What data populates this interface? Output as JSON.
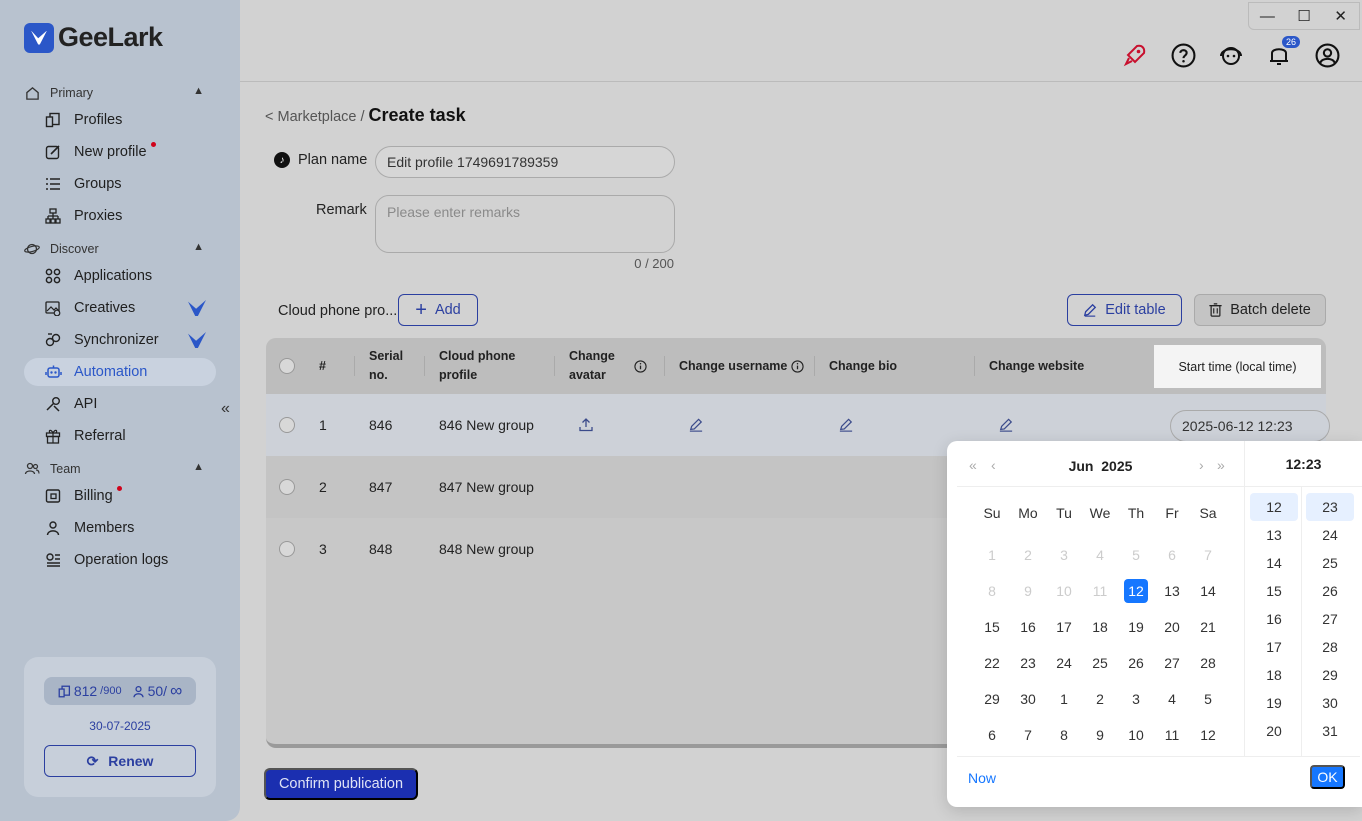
{
  "app": {
    "name": "GeeLark"
  },
  "sidebar": {
    "sections": {
      "primary": "Primary",
      "discover": "Discover",
      "team": "Team"
    },
    "items": {
      "profiles": "Profiles",
      "new_profile": "New profile",
      "groups": "Groups",
      "proxies": "Proxies",
      "applications": "Applications",
      "creatives": "Creatives",
      "synchronizer": "Synchronizer",
      "automation": "Automation",
      "api": "API",
      "referral": "Referral",
      "billing": "Billing",
      "members": "Members",
      "operation_logs": "Operation logs"
    },
    "plan": {
      "profiles_used": "812",
      "profiles_total": "/900",
      "members_used": "50/",
      "members_total": "∞",
      "expiry": "30-07-2025",
      "renew_label": "Renew"
    }
  },
  "topbar": {
    "notification_count": "26"
  },
  "breadcrumb": {
    "parent": "< Marketplace /",
    "current": "Create task"
  },
  "form": {
    "plan_name_label": "Plan name",
    "plan_name_value": "Edit profile 1749691789359",
    "remark_label": "Remark",
    "remark_placeholder": "Please enter remarks",
    "remark_counter": "0 / 200"
  },
  "toolbar": {
    "cloud_phone_label": "Cloud phone pro...",
    "add_label": "Add",
    "edit_table_label": "Edit table",
    "batch_delete_label": "Batch delete"
  },
  "table": {
    "headers": {
      "index": "#",
      "serial": "Serial no.",
      "profile": "Cloud phone profile",
      "avatar": "Change avatar",
      "username": "Change username",
      "bio": "Change bio",
      "website": "Change website",
      "start_time": "Start time (local time)"
    },
    "rows": [
      {
        "index": "1",
        "serial": "846",
        "profile": "846 New group",
        "start_time": "2025-06-12 12:23"
      },
      {
        "index": "2",
        "serial": "847",
        "profile": "847 New group"
      },
      {
        "index": "3",
        "serial": "848",
        "profile": "848 New group"
      }
    ]
  },
  "confirm_label": "Confirm publication",
  "datepicker": {
    "month_label": "Jun",
    "year_label": "2025",
    "time_label": "12:23",
    "weekdays": [
      "Su",
      "Mo",
      "Tu",
      "We",
      "Th",
      "Fr",
      "Sa"
    ],
    "days": [
      {
        "d": "1",
        "m": true
      },
      {
        "d": "2",
        "m": true
      },
      {
        "d": "3",
        "m": true
      },
      {
        "d": "4",
        "m": true
      },
      {
        "d": "5",
        "m": true
      },
      {
        "d": "6",
        "m": true
      },
      {
        "d": "7",
        "m": true
      },
      {
        "d": "8",
        "m": true
      },
      {
        "d": "9",
        "m": true
      },
      {
        "d": "10",
        "m": true
      },
      {
        "d": "11",
        "m": true
      },
      {
        "d": "12",
        "s": true
      },
      {
        "d": "13"
      },
      {
        "d": "14"
      },
      {
        "d": "15"
      },
      {
        "d": "16"
      },
      {
        "d": "17"
      },
      {
        "d": "18"
      },
      {
        "d": "19"
      },
      {
        "d": "20"
      },
      {
        "d": "21"
      },
      {
        "d": "22"
      },
      {
        "d": "23"
      },
      {
        "d": "24"
      },
      {
        "d": "25"
      },
      {
        "d": "26"
      },
      {
        "d": "27"
      },
      {
        "d": "28"
      },
      {
        "d": "29"
      },
      {
        "d": "30"
      },
      {
        "d": "1"
      },
      {
        "d": "2"
      },
      {
        "d": "3"
      },
      {
        "d": "4"
      },
      {
        "d": "5"
      },
      {
        "d": "6"
      },
      {
        "d": "7"
      },
      {
        "d": "8"
      },
      {
        "d": "9"
      },
      {
        "d": "10"
      },
      {
        "d": "11"
      },
      {
        "d": "12"
      }
    ],
    "hours": [
      "12",
      "13",
      "14",
      "15",
      "16",
      "17",
      "18",
      "19",
      "20"
    ],
    "minutes": [
      "23",
      "24",
      "25",
      "26",
      "27",
      "28",
      "29",
      "30",
      "31"
    ],
    "now_label": "Now",
    "ok_label": "OK"
  }
}
